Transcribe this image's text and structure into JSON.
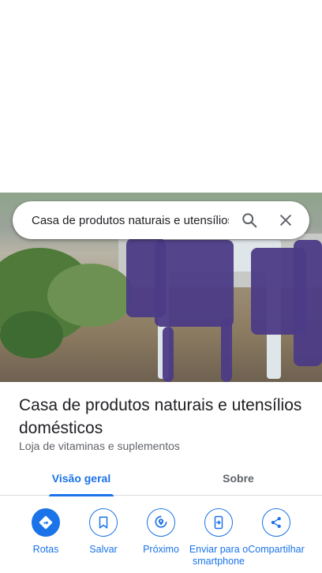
{
  "search": {
    "query": "Casa de produtos naturais e utensílios domésticos"
  },
  "place": {
    "name": "Casa de produtos naturais e utensílios domésticos",
    "category": "Loja de vitaminas e suplementos"
  },
  "tabs": [
    {
      "label": "Visão geral",
      "active": true
    },
    {
      "label": "Sobre",
      "active": false
    }
  ],
  "actions": [
    {
      "label": "Rotas",
      "icon": "directions-icon",
      "primary": true
    },
    {
      "label": "Salvar",
      "icon": "bookmark-icon",
      "primary": false
    },
    {
      "label": "Próximo",
      "icon": "nearby-icon",
      "primary": false
    },
    {
      "label": "Enviar para o smartphone",
      "icon": "send-to-phone-icon",
      "primary": false
    },
    {
      "label": "Compartilhar",
      "icon": "share-icon",
      "primary": false
    }
  ],
  "colors": {
    "accent": "#1a73e8",
    "text": "#202124",
    "secondary_text": "#5f6368"
  }
}
